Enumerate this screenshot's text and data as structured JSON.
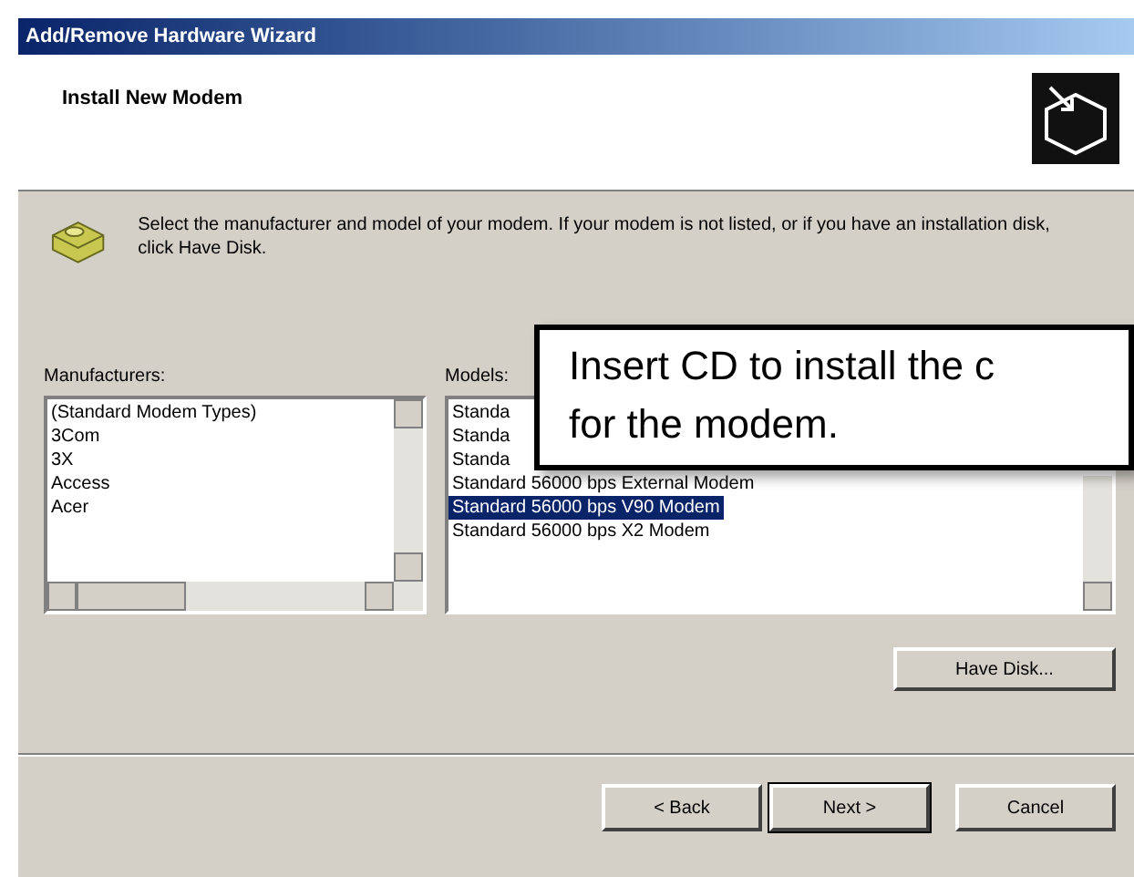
{
  "window": {
    "title": "Add/Remove Hardware Wizard"
  },
  "header": {
    "title": "Install New Modem"
  },
  "instruction": "Select the manufacturer and model of your modem. If your modem is not listed, or if you have an installation disk, click Have Disk.",
  "manufacturers": {
    "label": "Manufacturers:",
    "items": [
      {
        "text": "(Standard Modem Types)",
        "selected": false
      },
      {
        "text": "3Com",
        "selected": false
      },
      {
        "text": "3X",
        "selected": false
      },
      {
        "text": "Access",
        "selected": false
      },
      {
        "text": "Acer",
        "selected": false
      }
    ]
  },
  "models": {
    "label": "Models:",
    "items": [
      {
        "text": "Standa",
        "selected": false
      },
      {
        "text": "Standa",
        "selected": false
      },
      {
        "text": "Standa",
        "selected": false
      },
      {
        "text": "Standard 56000 bps External Modem",
        "selected": false
      },
      {
        "text": "Standard 56000 bps V90 Modem",
        "selected": true
      },
      {
        "text": "Standard 56000 bps X2 Modem",
        "selected": false
      }
    ]
  },
  "have_disk_button": "Have Disk...",
  "buttons": [
    {
      "label": "< Back",
      "default": false
    },
    {
      "label": "Next >",
      "default": true
    },
    {
      "label": "Cancel",
      "default": false
    }
  ],
  "callout": {
    "lines": [
      "Insert CD to install the c",
      "for the modem."
    ]
  }
}
